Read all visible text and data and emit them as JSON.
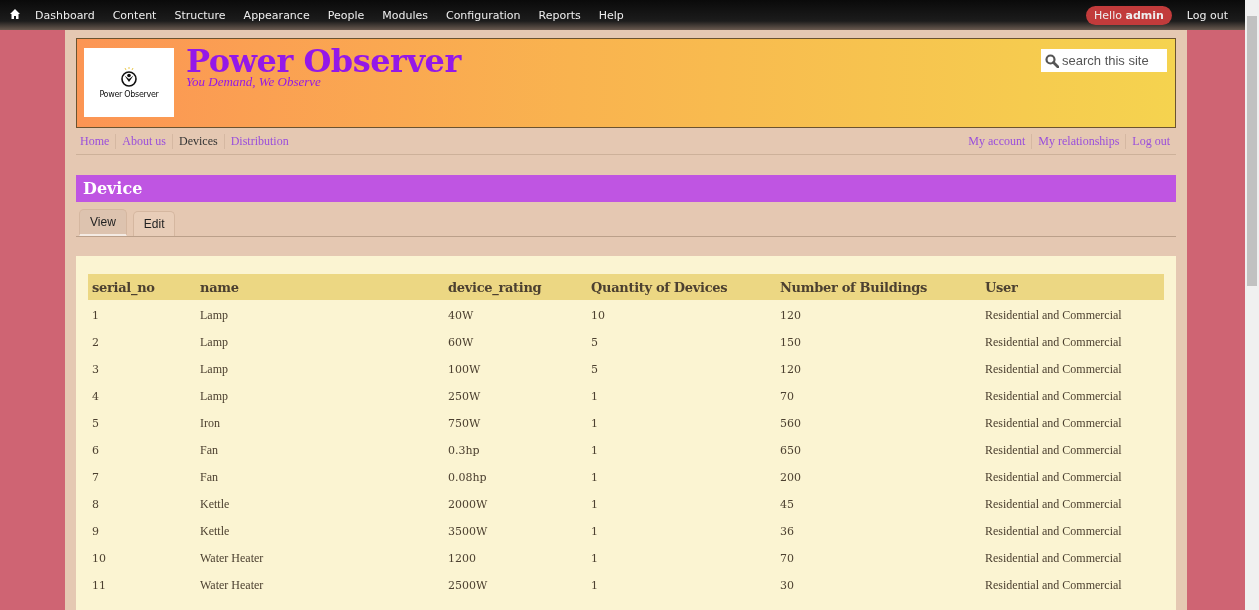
{
  "toolbar": {
    "items": [
      "Dashboard",
      "Content",
      "Structure",
      "Appearance",
      "People",
      "Modules",
      "Configuration",
      "Reports",
      "Help"
    ],
    "greeting": "Hello **admin**",
    "logout": "Log out"
  },
  "site": {
    "logo_text": "Power Observer",
    "name": "Power Observer",
    "slogan": "You Demand, We Observe",
    "search": {
      "placeholder": "search this site"
    }
  },
  "main_menu": [
    {
      "label": "Home",
      "selected": false
    },
    {
      "label": "About us",
      "selected": false
    },
    {
      "label": "Devices",
      "selected": true
    },
    {
      "label": "Distribution",
      "selected": false
    }
  ],
  "secondary_menu": [
    "My account",
    "My relationships",
    "Log out"
  ],
  "page_title": "Device",
  "tabs": [
    {
      "label": "View",
      "selected": true
    },
    {
      "label": "Edit",
      "selected": false
    }
  ],
  "table": {
    "columns": [
      "serial_no",
      "name",
      "device_rating",
      "Quantity of Devices",
      "Number of Buildings",
      "User"
    ],
    "rows": [
      [
        "1",
        "Lamp",
        "40W",
        "10",
        "120",
        "Residential and Commercial"
      ],
      [
        "2",
        "Lamp",
        "60W",
        "5",
        "150",
        "Residential and Commercial"
      ],
      [
        "3",
        "Lamp",
        "100W",
        "5",
        "120",
        "Residential and Commercial"
      ],
      [
        "4",
        "Lamp",
        "250W",
        "1",
        "70",
        "Residential and Commercial"
      ],
      [
        "5",
        "Iron",
        "750W",
        "1",
        "560",
        "Residential and Commercial"
      ],
      [
        "6",
        "Fan",
        "0.3hp",
        "1",
        "650",
        "Residential and Commercial"
      ],
      [
        "7",
        "Fan",
        "0.08hp",
        "1",
        "200",
        "Residential and Commercial"
      ],
      [
        "8",
        "Kettle",
        "2000W",
        "1",
        "45",
        "Residential and Commercial"
      ],
      [
        "9",
        "Kettle",
        "3500W",
        "1",
        "36",
        "Residential and Commercial"
      ],
      [
        "10",
        "Water Heater",
        "1200",
        "1",
        "70",
        "Residential and Commercial"
      ],
      [
        "11",
        "Water Heater",
        "2500W",
        "1",
        "30",
        "Residential and Commercial"
      ]
    ]
  }
}
